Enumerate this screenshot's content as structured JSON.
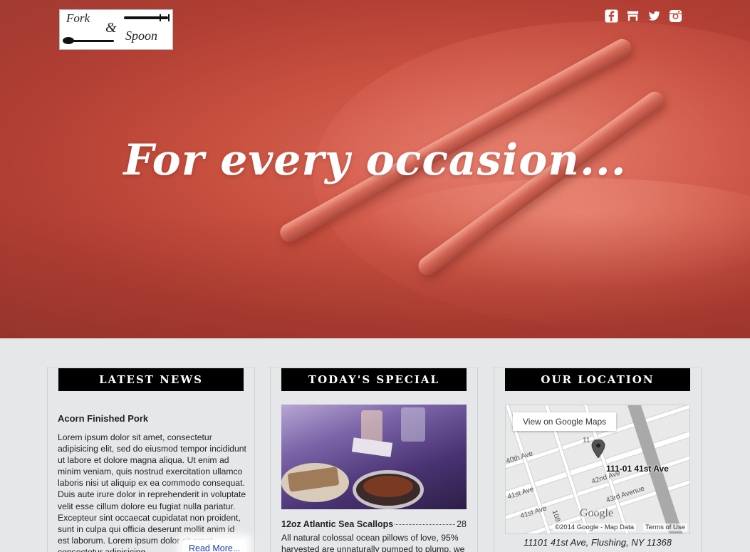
{
  "header": {
    "logo_text_1": "Fork",
    "logo_amp": "&",
    "logo_text_2": "Spoon",
    "social": [
      {
        "name": "facebook-icon"
      },
      {
        "name": "foursquare-icon"
      },
      {
        "name": "twitter-icon"
      },
      {
        "name": "instagram-icon"
      }
    ]
  },
  "hero": {
    "tagline": "For every occasion..."
  },
  "news": {
    "heading": "LATEST NEWS",
    "title": "Acorn Finished Pork",
    "body": "Lorem ipsum dolor sit amet, consectetur adipisicing elit, sed do eiusmod tempor incididunt ut labore et dolore magna aliqua. Ut enim ad minim veniam, quis nostrud exercitation ullamco laboris nisi ut aliquip ex ea commodo consequat. Duis aute irure dolor in reprehenderit in voluptate velit esse cillum dolore eu fugiat nulla pariatur. Excepteur sint occaecat cupidatat non proident, sunt in culpa qui officia deserunt mollit anim id est laborum. Lorem ipsum dolor sit amet, consectetur adipisicing",
    "read_more": "Read More..."
  },
  "special": {
    "heading": "TODAY'S SPECIAL",
    "item_name": "12oz Atlantic Sea Scallops",
    "item_price": "28",
    "description": "All natural colossal ocean pillows of love, 95% harvested are unnaturally pumped to plump, we"
  },
  "location": {
    "heading": "OUR LOCATION",
    "view_button": "View on Google Maps",
    "marker_label": "111-01 41st Ave",
    "map_copyright": "©2014 Google - Map Data",
    "map_terms": "Terms of Use",
    "map_brand": "Google",
    "street_labels": [
      "40th Ave",
      "41st Ave",
      "42nd Ave",
      "43rd Avenue",
      "41st Ave",
      "108",
      "11"
    ],
    "address": "11101 41st Ave, Flushing, NY 11368"
  }
}
